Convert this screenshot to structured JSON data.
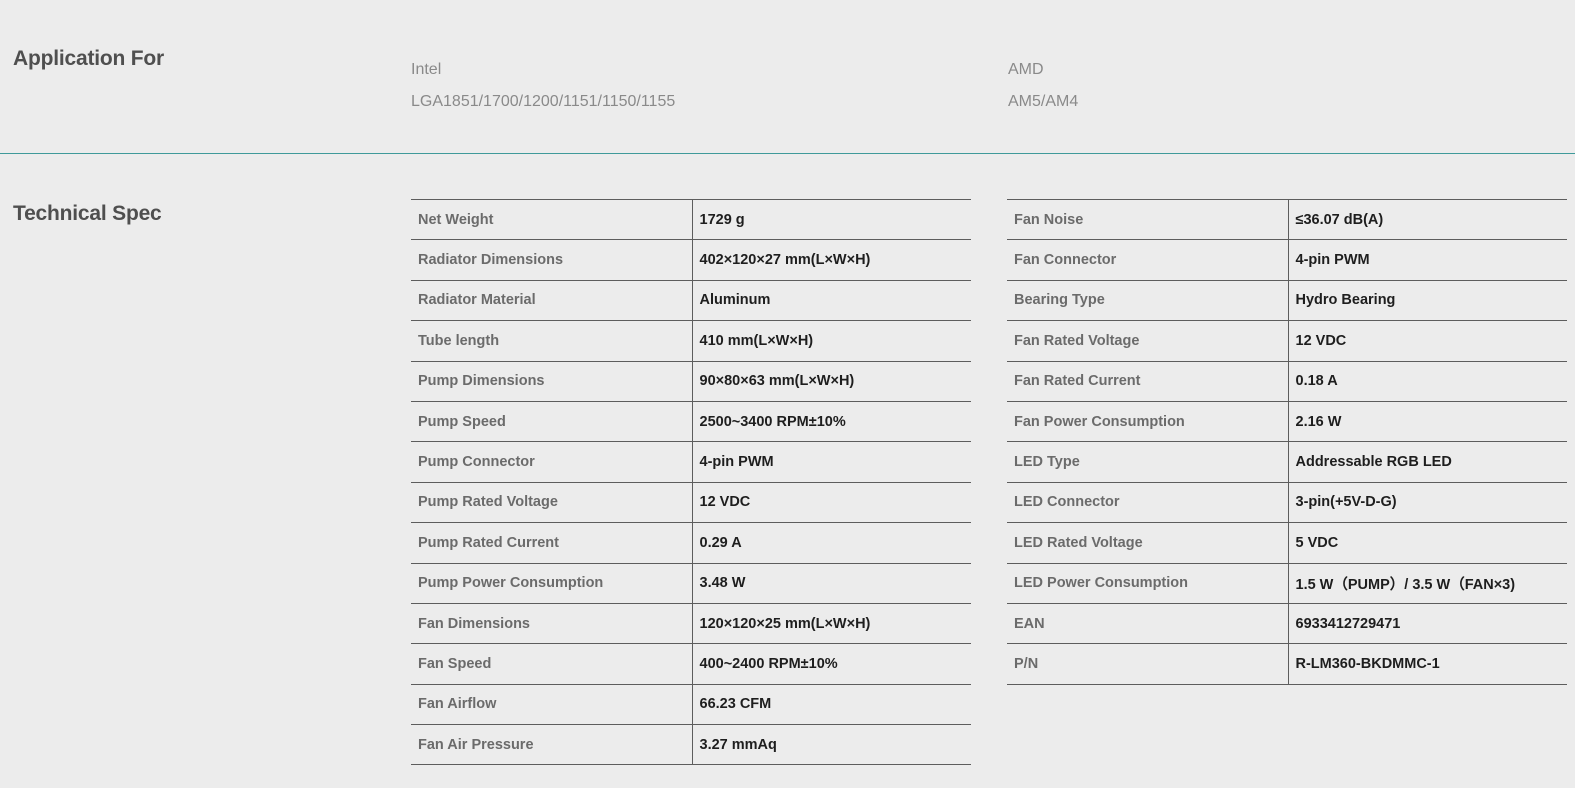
{
  "application": {
    "title": "Application For",
    "intel": {
      "brand": "Intel",
      "sockets": "LGA1851/1700/1200/1151/1150/1155"
    },
    "amd": {
      "brand": "AMD",
      "sockets": "AM5/AM4"
    }
  },
  "tech_spec": {
    "title": "Technical Spec",
    "left_rows": [
      {
        "label": "Net Weight",
        "value": "1729 g"
      },
      {
        "label": "Radiator Dimensions",
        "value": "402×120×27 mm(L×W×H)"
      },
      {
        "label": "Radiator Material",
        "value": "Aluminum"
      },
      {
        "label": "Tube length",
        "value": "410 mm(L×W×H)"
      },
      {
        "label": "Pump Dimensions",
        "value": "90×80×63 mm(L×W×H)"
      },
      {
        "label": "Pump Speed",
        "value": "2500~3400 RPM±10%"
      },
      {
        "label": "Pump Connector",
        "value": "4-pin PWM"
      },
      {
        "label": "Pump Rated Voltage",
        "value": "12 VDC"
      },
      {
        "label": "Pump Rated Current",
        "value": "0.29 A"
      },
      {
        "label": "Pump Power Consumption",
        "value": "3.48 W"
      },
      {
        "label": "Fan Dimensions",
        "value": "120×120×25 mm(L×W×H)"
      },
      {
        "label": "Fan Speed",
        "value": "400~2400 RPM±10%"
      },
      {
        "label": "Fan Airflow",
        "value": "66.23 CFM"
      },
      {
        "label": "Fan Air Pressure",
        "value": "3.27 mmAq"
      }
    ],
    "right_rows": [
      {
        "label": "Fan Noise",
        "value": "≤36.07 dB(A)"
      },
      {
        "label": "Fan Connector",
        "value": "4-pin PWM"
      },
      {
        "label": "Bearing Type",
        "value": "Hydro Bearing"
      },
      {
        "label": "Fan Rated Voltage",
        "value": "12 VDC"
      },
      {
        "label": "Fan Rated Current",
        "value": "0.18 A"
      },
      {
        "label": "Fan Power Consumption",
        "value": "2.16 W"
      },
      {
        "label": "LED Type",
        "value": "Addressable RGB LED"
      },
      {
        "label": "LED Connector",
        "value": "3-pin(+5V-D-G)"
      },
      {
        "label": "LED Rated Voltage",
        "value": "5 VDC"
      },
      {
        "label": "LED Power Consumption",
        "value": "1.5 W（PUMP）/ 3.5 W（FAN×3)"
      },
      {
        "label": "EAN",
        "value": "6933412729471"
      },
      {
        "label": "P/N",
        "value": "R-LM360-BKDMMC-1"
      }
    ]
  }
}
